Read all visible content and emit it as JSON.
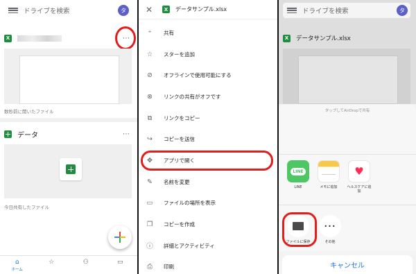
{
  "panel1": {
    "search_placeholder": "ドライブを検索",
    "avatar_initial": "タ",
    "file1_caption": "数秒前に開いたファイル",
    "file2_name": "データ",
    "file2_caption": "今日共有したファイル",
    "more_glyph": "⋯",
    "nav": {
      "home_label": "ホーム"
    }
  },
  "panel2": {
    "file_title": "データサンプル.xlsx",
    "xls_badge": "X",
    "menu_items": [
      {
        "label": "共有",
        "icon": "person-add-icon",
        "glyph": "⁺"
      },
      {
        "label": "スターを追加",
        "icon": "star-icon",
        "glyph": "☆"
      },
      {
        "label": "オフラインで使用可能にする",
        "icon": "offline-icon",
        "glyph": "⊘"
      },
      {
        "label": "リンクの共有がオフです",
        "icon": "link-off-icon",
        "glyph": "⊗"
      },
      {
        "label": "リンクをコピー",
        "icon": "copy-link-icon",
        "glyph": "⧉"
      },
      {
        "label": "コピーを送信",
        "icon": "send-icon",
        "glyph": "↪"
      },
      {
        "label": "アプリで開く",
        "icon": "open-with-icon",
        "glyph": "✥"
      },
      {
        "label": "名前を変更",
        "icon": "pencil-icon",
        "glyph": "✎"
      },
      {
        "label": "ファイルの場所を表示",
        "icon": "folder-icon",
        "glyph": "▭"
      },
      {
        "label": "コピーを作成",
        "icon": "duplicate-icon",
        "glyph": "❐"
      },
      {
        "label": "詳細とアクティビティ",
        "icon": "info-icon",
        "glyph": "ⓘ"
      },
      {
        "label": "印刷",
        "icon": "print-icon",
        "glyph": "⎙"
      }
    ]
  },
  "panel3": {
    "search_placeholder": "ドライブを検索",
    "avatar_initial": "タ",
    "file_title": "データサンプル.xlsx",
    "airdrop_hint": "タップしてAirDropで共有",
    "apps": [
      {
        "label": "LINE",
        "icon_text": "LINE"
      },
      {
        "label": "メモに追加"
      },
      {
        "label": "ヘルスケアに追加"
      }
    ],
    "actions": [
      {
        "label": "ファイルに保存"
      },
      {
        "label": "その他",
        "glyph": "•••"
      }
    ],
    "cancel_label": "キャンセル"
  },
  "colors": {
    "highlight_ring": "#e31c1c",
    "drive_green": "#1e8e3e",
    "line_green": "#4cc764",
    "ios_blue": "#1a73e8",
    "avatar": "#5b5fc7"
  }
}
